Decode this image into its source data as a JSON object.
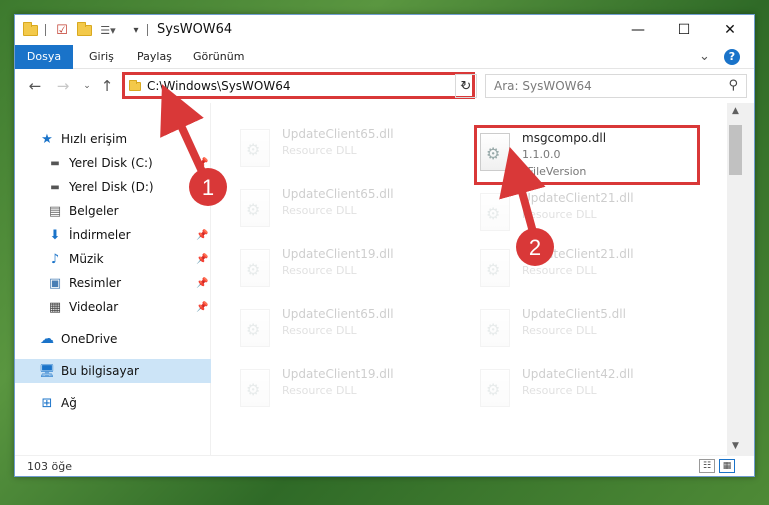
{
  "window": {
    "title": "SysWOW64",
    "minimize": "—",
    "maximize": "☐",
    "close": "✕"
  },
  "ribbon": {
    "tabs": [
      "Dosya",
      "Giriş",
      "Paylaş",
      "Görünüm"
    ],
    "expand": "⌄",
    "help": "?"
  },
  "address": {
    "path": "C:\\Windows\\SysWOW64",
    "search_placeholder": "Ara: SysWOW64"
  },
  "sidebar": {
    "items": [
      {
        "label": "Hızlı erişim",
        "icon": "star-icon"
      },
      {
        "label": "Yerel Disk (C:)",
        "icon": "drive-icon"
      },
      {
        "label": "Yerel Disk (D:)",
        "icon": "drive-icon"
      },
      {
        "label": "Belgeler",
        "icon": "documents-icon"
      },
      {
        "label": "İndirmeler",
        "icon": "download-icon"
      },
      {
        "label": "Müzik",
        "icon": "music-icon"
      },
      {
        "label": "Resimler",
        "icon": "pictures-icon"
      },
      {
        "label": "Videolar",
        "icon": "video-icon"
      },
      {
        "label": "OneDrive",
        "icon": "cloud-icon"
      },
      {
        "label": "Bu bilgisayar",
        "icon": "computer-icon"
      },
      {
        "label": "Ağ",
        "icon": "network-icon"
      }
    ]
  },
  "files": {
    "left": [
      {
        "name": "UpdateClient65.dll",
        "desc": "Resource DLL"
      },
      {
        "name": "UpdateClient65.dll",
        "desc": "Resource DLL"
      },
      {
        "name": "UpdateClient19.dll",
        "desc": "Resource DLL"
      },
      {
        "name": "UpdateClient65.dll",
        "desc": "Resource DLL"
      },
      {
        "name": "UpdateClient19.dll",
        "desc": "Resource DLL"
      }
    ],
    "right": [
      {
        "name": "msgcompo.dll",
        "desc": "1.1.0.0",
        "desc2": "*FileVersion"
      },
      {
        "name": "UpdateClient21.dll",
        "desc": "Resource DLL"
      },
      {
        "name": "UpdateClient21.dll",
        "desc": "Resource DLL"
      },
      {
        "name": "UpdateClient5.dll",
        "desc": "Resource DLL"
      },
      {
        "name": "UpdateClient42.dll",
        "desc": "Resource DLL"
      }
    ]
  },
  "status": {
    "count": "103 öğe"
  },
  "annotations": {
    "step1": "1",
    "step2": "2",
    "color": "#d93838"
  }
}
